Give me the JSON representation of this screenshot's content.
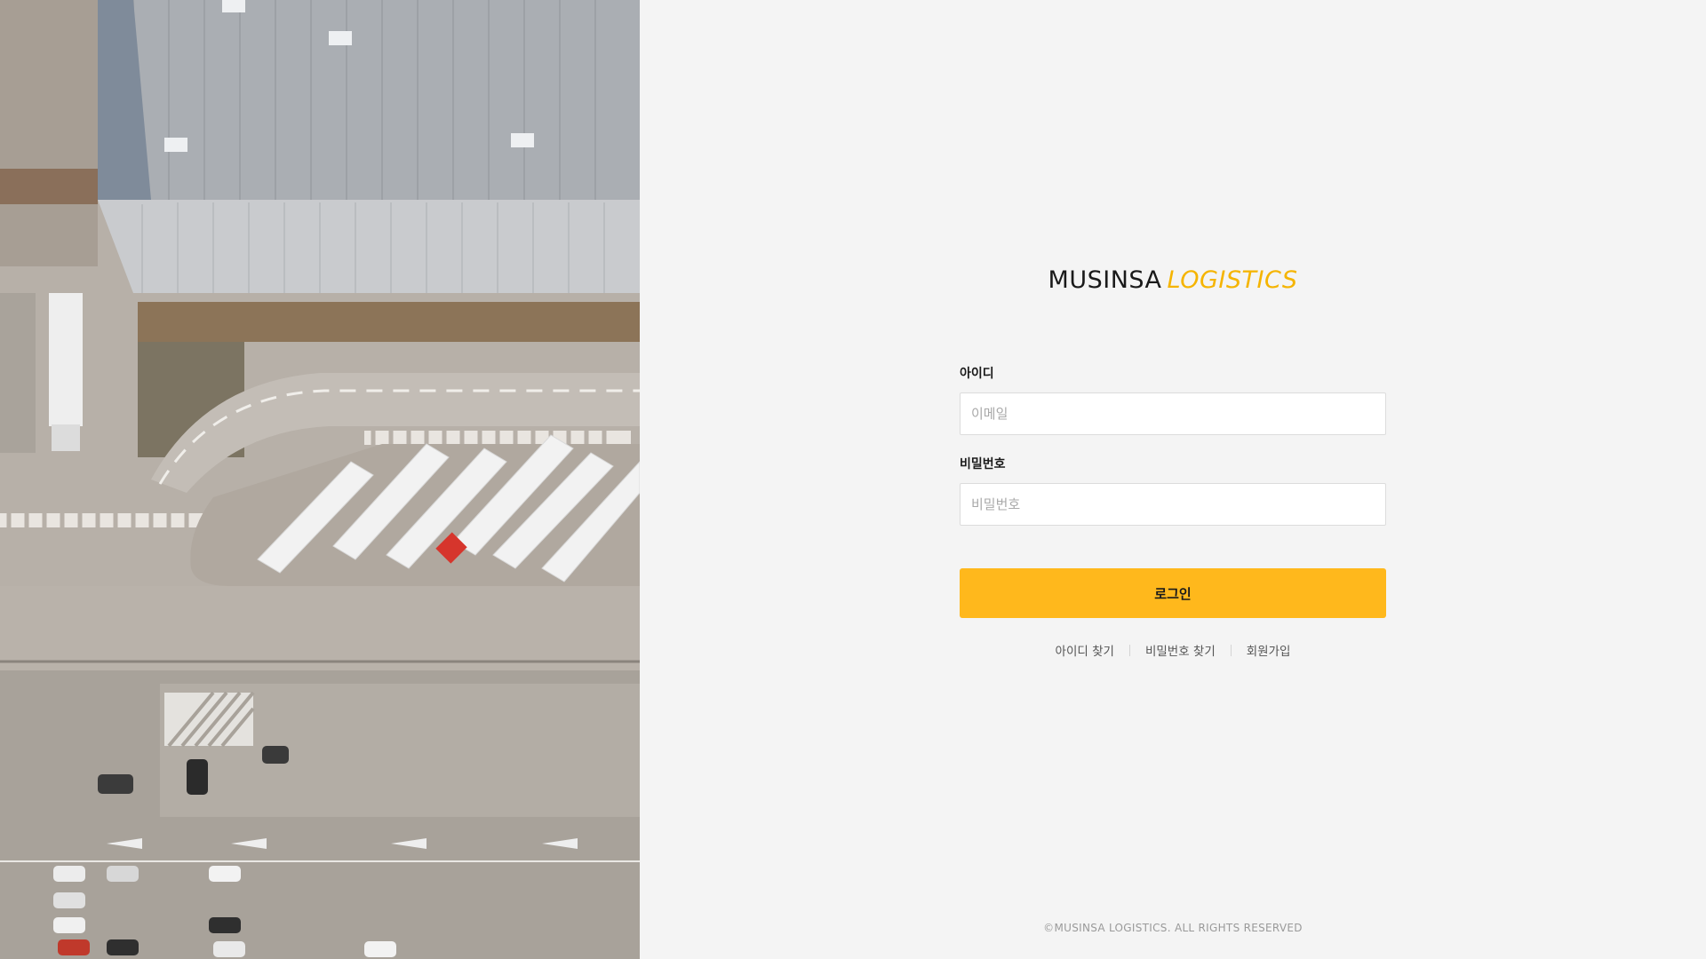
{
  "brand": {
    "name": "MUSINSA",
    "sub": "LOGISTICS"
  },
  "login": {
    "id_label": "아이디",
    "id_placeholder": "이메일",
    "id_value": "",
    "pw_label": "비밀번호",
    "pw_placeholder": "비밀번호",
    "pw_value": "",
    "submit_label": "로그인"
  },
  "links": {
    "find_id": "아이디 찾기",
    "find_pw": "비밀번호 찾기",
    "signup": "회원가입"
  },
  "footer": {
    "copyright": "©MUSINSA LOGISTICS. ALL RIGHTS RESERVED"
  },
  "colors": {
    "accent": "#ffb81c",
    "brand_sub": "#f5b400",
    "background": "#f4f4f4"
  },
  "icons": {
    "photo": "aerial-warehouse-photo"
  }
}
